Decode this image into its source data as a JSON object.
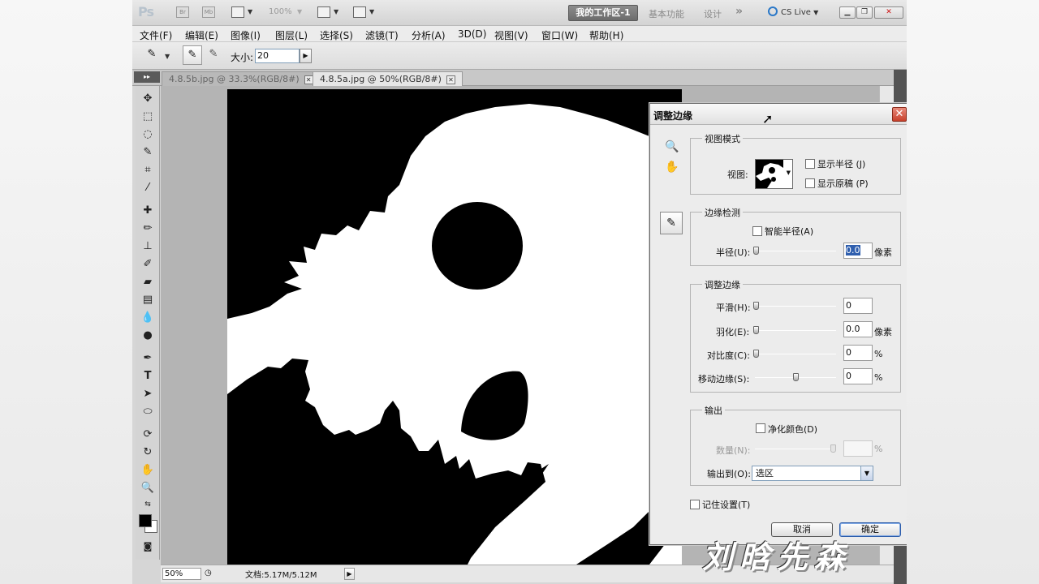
{
  "titlebar": {
    "logo": "Ps",
    "zoom_percent": "100%",
    "workspace_active": "我的工作区-1",
    "workspace_items": [
      "基本功能",
      "设计"
    ],
    "more": "»",
    "cs_live": "CS Live"
  },
  "menu": [
    "文件(F)",
    "编辑(E)",
    "图像(I)",
    "图层(L)",
    "选择(S)",
    "滤镜(T)",
    "分析(A)",
    "3D(D)",
    "视图(V)",
    "窗口(W)",
    "帮助(H)"
  ],
  "options": {
    "size_label": "大小:",
    "size_value": "20"
  },
  "tabs": [
    {
      "label": "4.8.5b.jpg @ 33.3%(RGB/8#)",
      "active": false
    },
    {
      "label": "4.8.5a.jpg @ 50%(RGB/8#)",
      "active": true
    }
  ],
  "status": {
    "zoom": "50%",
    "doc_info": "文档:5.17M/5.12M"
  },
  "dialog": {
    "title": "调整边缘",
    "view_mode": {
      "legend": "视图模式",
      "view_label": "视图:",
      "show_radius": "显示半径 (J)",
      "show_original": "显示原稿 (P)"
    },
    "edge_detection": {
      "legend": "边缘检测",
      "smart_radius": "智能半径(A)",
      "radius_label": "半径(U):",
      "radius_value": "0.0",
      "radius_unit": "像素"
    },
    "adjust_edge": {
      "legend": "调整边缘",
      "smooth_label": "平滑(H):",
      "smooth_value": "0",
      "feather_label": "羽化(E):",
      "feather_value": "0.0",
      "feather_unit": "像素",
      "contrast_label": "对比度(C):",
      "contrast_value": "0",
      "contrast_unit": "%",
      "shift_label": "移动边缘(S):",
      "shift_value": "0",
      "shift_unit": "%"
    },
    "output": {
      "legend": "输出",
      "decontaminate": "净化颜色(D)",
      "amount_label": "数量(N):",
      "amount_unit": "%",
      "output_to_label": "输出到(O):",
      "output_to_value": "选区"
    },
    "remember": "记住设置(T)",
    "cancel": "取消",
    "ok": "确定"
  },
  "watermark": "刘晗先森",
  "colors": {
    "accent": "#2a78c8",
    "close_red": "#c8402b",
    "canvas_bg": "#b4b4b4"
  }
}
